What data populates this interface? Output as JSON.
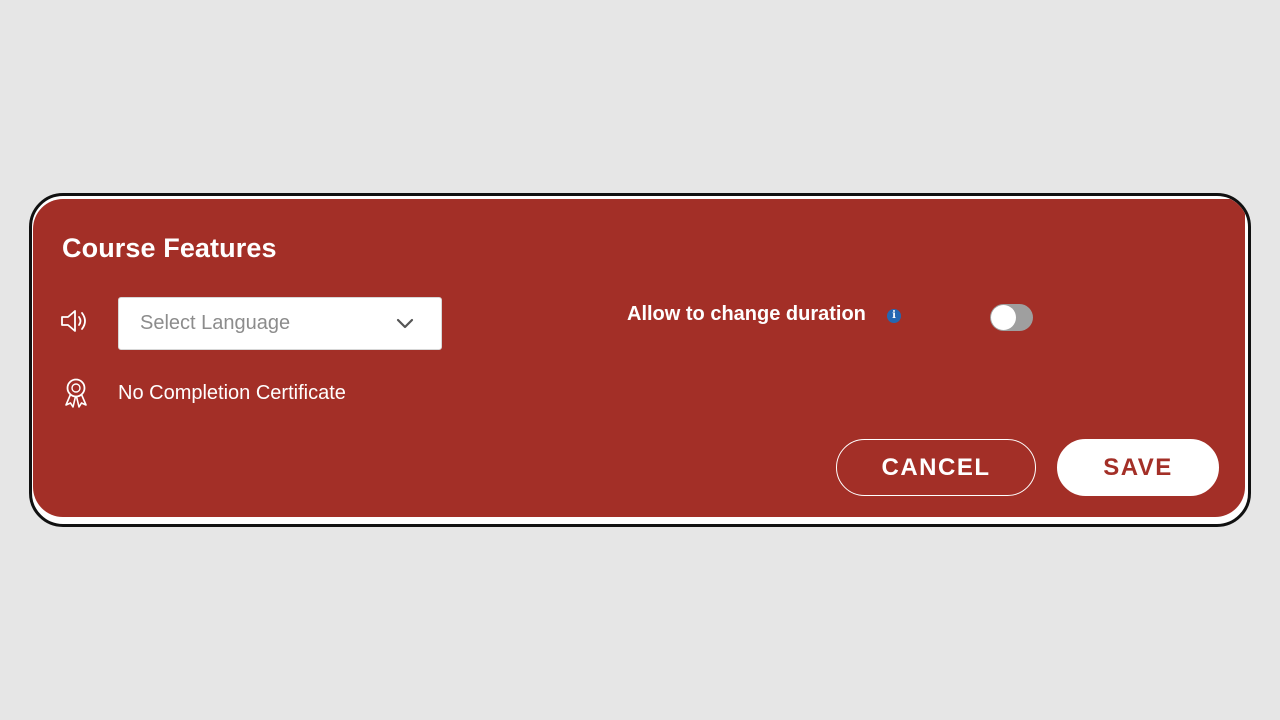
{
  "panel": {
    "title": "Course Features"
  },
  "language": {
    "icon": "speaker-icon",
    "select_value": "Select Language",
    "dropdown_icon": "chevron-down-icon"
  },
  "certificate": {
    "icon": "award-ribbon-icon",
    "label": "No Completion Certificate"
  },
  "duration": {
    "label": "Allow to change duration",
    "info_glyph": "i",
    "toggle_on": false
  },
  "actions": {
    "cancel_label": "CANCEL",
    "save_label": "SAVE"
  },
  "colors": {
    "panel_background": "#a32f27",
    "page_background": "#e6e6e6",
    "info_blue": "#2467b2",
    "toggle_off": "#9f9f9f"
  }
}
